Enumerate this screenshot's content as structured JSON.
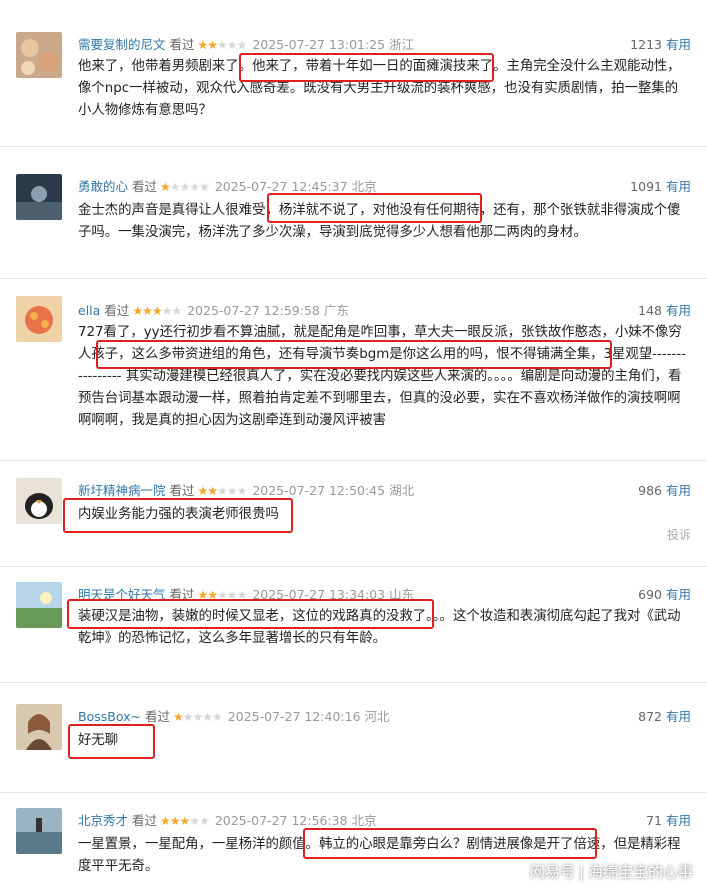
{
  "watched_label": "看过",
  "useful_label": "有用",
  "report_label": "投诉",
  "watermark": {
    "brand": "网易号",
    "divider": "|",
    "account": "海绵宝宝的心事"
  },
  "reviews": [
    {
      "user": "需要复制的尼文",
      "stars": 2,
      "time": "2025-07-27 13:01:25",
      "location": "浙江",
      "votes": "1213",
      "text": "他来了，他带着男频剧来了。他来了，带着十年如一日的面瘫演技来了。主角完全没什么主观能动性，像个npc一样被动，观众代入感奇差。既没有大男主升级流的装杯爽感，也没有实质剧情，拍一整集的小人物修炼有意思吗？"
    },
    {
      "user": "勇敢的心",
      "stars": 1,
      "time": "2025-07-27 12:45:37",
      "location": "北京",
      "votes": "1091",
      "text": "金士杰的声音是真得让人很难受，杨洋就不说了，对他没有任何期待，还有，那个张铁就非得演成个傻子吗。一集没演完，杨洋洗了多少次澡，导演到底觉得多少人想看他那二两肉的身材。"
    },
    {
      "user": "ella",
      "stars": 3,
      "time": "2025-07-27 12:59:58",
      "location": "广东",
      "votes": "148",
      "text": "727看了，yy还行初步看不算油腻，就是配角是咋回事，草大夫一眼反派，张铁故作憨态，小妹不像穷人孩子，这么多带资进组的角色，还有导演节奏bgm是你这么用的吗，恨不得铺满全集，3星观望---------------- 其实动漫建模已经很真人了，实在没必要找内娱这些人来演的。。。。编剧是向动漫的主角们，看预告台词基本跟动漫一样，照着拍肯定差不到哪里去，但真的没必要，实在不喜欢杨洋做作的演技啊啊啊啊啊，我是真的担心因为这剧牵连到动漫风评被害"
    },
    {
      "user": "新圩精神病一院",
      "stars": 2,
      "time": "2025-07-27 12:50:45",
      "location": "湖北",
      "votes": "986",
      "text": "内娱业务能力强的表演老师很贵吗"
    },
    {
      "user": "明天是个好天气",
      "stars": 2,
      "time": "2025-07-27 13:34:03",
      "location": "山东",
      "votes": "690",
      "text": "装硬汉是油物，装嫩的时候又显老，这位的戏路真的没救了。。。这个妆造和表演彻底勾起了我对《武动乾坤》的恐怖记忆，这么多年显著增长的只有年龄。"
    },
    {
      "user": "BossBox~",
      "stars": 1,
      "time": "2025-07-27 12:40:16",
      "location": "河北",
      "votes": "872",
      "text": "好无聊"
    },
    {
      "user": "北京秀才",
      "stars": 3,
      "time": "2025-07-27 12:56:38",
      "location": "北京",
      "votes": "71",
      "text": "一星置景，一星配角，一星杨洋的颜值。韩立的心眼是靠旁白么？剧情进展像是开了倍速，但是精彩程度平平无奇。"
    }
  ]
}
